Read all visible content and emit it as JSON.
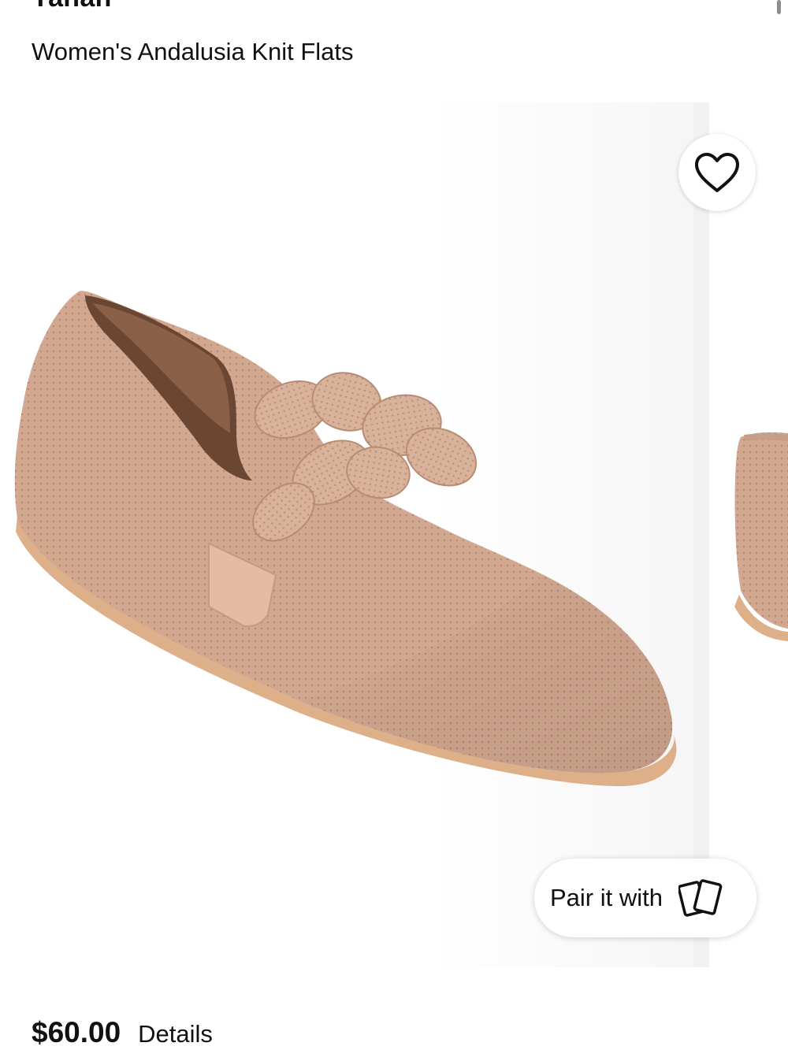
{
  "product": {
    "brand": "Yahan",
    "name": "Women's Andalusia Knit Flats",
    "price": "$60.00",
    "details_label": "Details"
  },
  "gallery": {
    "favorite_icon": "heart-outline-icon",
    "pair_label": "Pair it with",
    "pair_icon": "cards-icon"
  },
  "colors": {
    "shoe_knit": "#d4ab93",
    "sole": "#ddb089",
    "text": "#111111"
  }
}
